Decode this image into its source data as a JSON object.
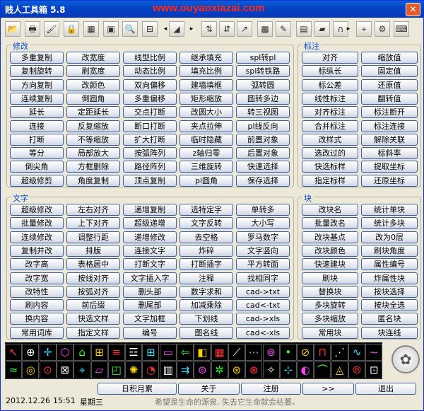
{
  "window": {
    "title": "贱人工具箱 5.8",
    "watermark": "www.ouyaoxiazai.com",
    "close": "✕"
  },
  "toolbar": [
    {
      "icon": "folder-icon",
      "glyph": "📂"
    },
    {
      "icon": "printer-icon",
      "glyph": "🖶"
    },
    {
      "icon": "brush-icon",
      "glyph": "🖌"
    },
    {
      "icon": "lock-icon",
      "glyph": "🔒"
    },
    {
      "icon": "calculator-icon",
      "glyph": "▦"
    },
    {
      "icon": "window-icon",
      "glyph": "▣"
    },
    {
      "icon": "magnifier-icon",
      "glyph": "🔍"
    },
    {
      "icon": "ruler-icon",
      "glyph": "⊟"
    },
    {
      "icon": "flag-icon",
      "glyph": "◢"
    },
    {
      "icon": "layers-icon",
      "glyph": "⇅"
    },
    {
      "icon": "split-icon",
      "glyph": "⇵"
    },
    {
      "icon": "arrow-icon",
      "glyph": "↗"
    },
    {
      "icon": "palette-icon",
      "glyph": "▩"
    },
    {
      "icon": "edit-icon",
      "glyph": "✎"
    },
    {
      "icon": "table-icon",
      "glyph": "▤"
    },
    {
      "icon": "eraser-icon",
      "glyph": "▰"
    },
    {
      "icon": "magnet-icon",
      "glyph": "∩"
    },
    {
      "icon": "crosshair-icon",
      "glyph": "⌖"
    },
    {
      "icon": "gear-icon",
      "glyph": "⚙"
    },
    {
      "icon": "keyboard-icon",
      "glyph": "⌨"
    }
  ],
  "groups": {
    "modify": "修改",
    "text": "文字",
    "annotate": "标注",
    "block": "块"
  },
  "modify_buttons": [
    "多重复制",
    "改宽度",
    "线型比例",
    "继承填充",
    "spl转pl",
    "复制旋转",
    "刷宽度",
    "动态比例",
    "填充比例",
    "spl转铁路",
    "方向复制",
    "改颜色",
    "双向偏移",
    "建墙填框",
    "弧转圆",
    "连续复制",
    "倒圆角",
    "多重偏移",
    "矩形缩放",
    "圆转多边",
    "延长",
    "定距延长",
    "交点打断",
    "改圆大小",
    "转三视图",
    "连接",
    "反复缩放",
    "断口打断",
    "夹点拉伸",
    "pl线反向",
    "打断",
    "不等缩放",
    "扩大打断",
    "临时隐藏",
    "前置对象",
    "等分",
    "局部放大",
    "按弧阵列",
    "z轴归零",
    "后置对象",
    "倒尖角",
    "方框删除",
    "路径阵列",
    "三维旋转",
    "快速选择",
    "超级修剪",
    "角度复制",
    "顶点复制",
    "pl圆角",
    "保存选择"
  ],
  "annotate_buttons": [
    "对齐",
    "缩放值",
    "标纵长",
    "固定值",
    "标公差",
    "还原值",
    "线性标注",
    "翻转值",
    "对齐标注",
    "标注断开",
    "合并标注",
    "标注连接",
    "改样式",
    "解除关联",
    "选改过的",
    "标斜率",
    "快选标样",
    "提取坐标",
    "指定标样",
    "还原坐标"
  ],
  "text_buttons": [
    "超级修改",
    "左右对齐",
    "递增复制",
    "选特定字",
    "单转多",
    "批量修改",
    "上下对齐",
    "超级递增",
    "文字反转",
    "大小写",
    "连续修改",
    "调整行距",
    "递增修改",
    "去空格",
    "罗马数字",
    "复制并改",
    "排版",
    "连接文字",
    "炸碎",
    "文字竖向",
    "改字高",
    "表格居中",
    "打断文字",
    "打断插字",
    "平方转面",
    "改字宽",
    "按线对齐",
    "文字插入字",
    "注释",
    "找相同字",
    "改特性",
    "按弧对齐",
    "删头部",
    "数字求和",
    "cad->txt",
    "刷内容",
    "前后缀",
    "删尾部",
    "加减乘除",
    "cad<-txt",
    "换内容",
    "快选文样",
    "文字加框",
    "下划线",
    "cad->xls",
    "常用词库",
    "指定文样",
    "编号",
    "图名线",
    "cad<-xls"
  ],
  "block_buttons": [
    "改块名",
    "统计单块",
    "批量改名",
    "统计多块",
    "改块基点",
    "改为0层",
    "改块颜色",
    "刷块角度",
    "快速建块",
    "属性编号",
    "刷块",
    "炸属性块",
    "替换块",
    "按块选择",
    "多块旋转",
    "按块全选",
    "多块缩放",
    "匿名块",
    "常用块",
    "块连线"
  ],
  "icon_grid_colors": [
    "#FF3030",
    "#FFD200",
    "#30FF30",
    "#FF40FF",
    "#30E0FF",
    "#FFFFFF"
  ],
  "bottom_buttons": {
    "calendar": "日积月累",
    "about": "关于",
    "register": "注册",
    "next": ">>",
    "exit": "退出"
  },
  "status": {
    "date": "2012.12.26",
    "time": "15:51",
    "weekday": "星期三",
    "message": "希望是生命的源泉, 失去它生命就会枯萎。"
  }
}
